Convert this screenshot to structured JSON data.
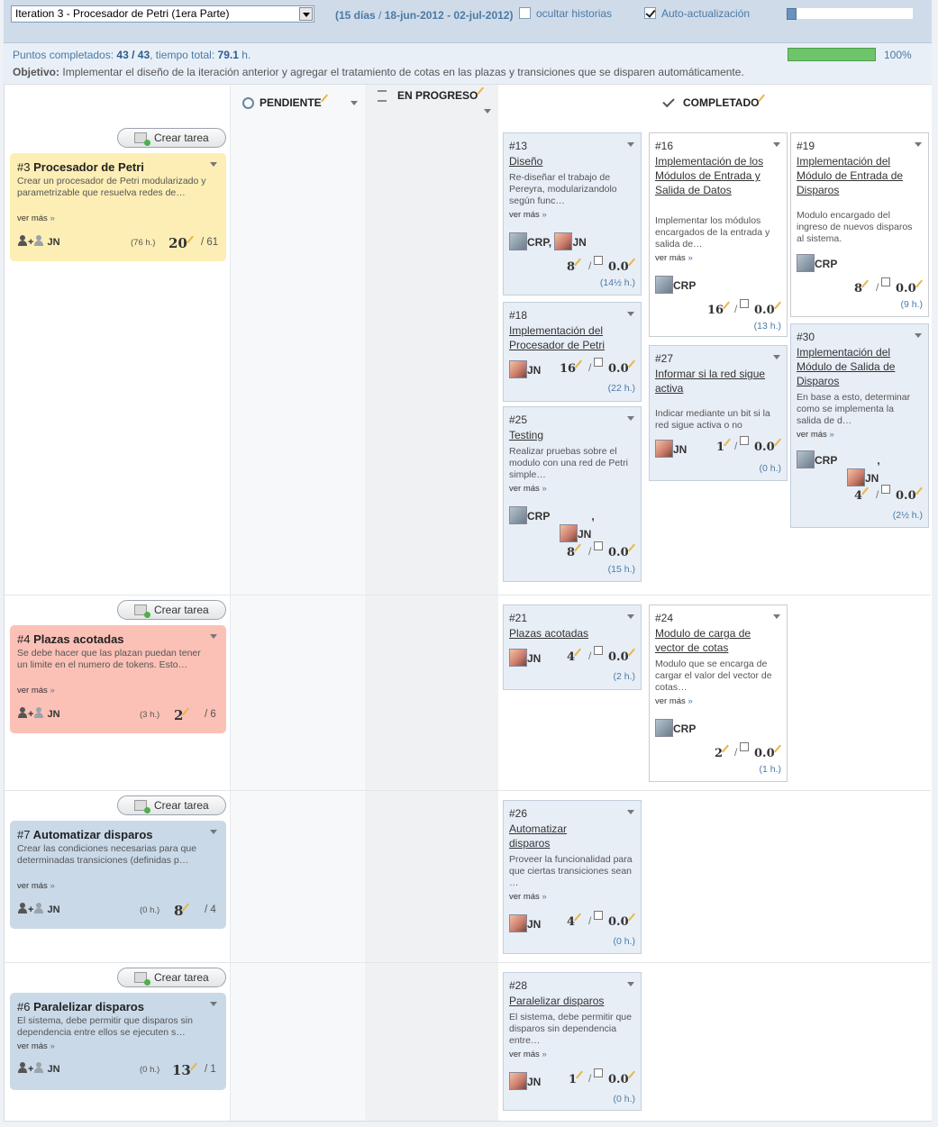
{
  "header": {
    "iteration_select": "Iteration 3 - Procesador de Petri (1era Parte)",
    "range_days": "15 días",
    "range_sep": "/",
    "range_dates": "18-jun-2012 - 02-jul-2012",
    "hide_stories_label": "ocultar historias",
    "hide_stories_checked": false,
    "auto_update_label": "Auto-actualización",
    "auto_update_checked": true
  },
  "info": {
    "points_label": "Puntos completados:",
    "points_value": "43 / 43",
    "time_label": ", tiempo total:",
    "time_value": "79.1",
    "time_unit": "h.",
    "objective_label": "Objetivo:",
    "objective_text": "Implementar el diseño de la iteración anterior y agregar el tratamiento de cotas en las plazas y transiciones que se disparen automáticamente.",
    "progress": 1.0,
    "progress_label": "100%"
  },
  "columns": {
    "pending": "PENDIENTE",
    "in_progress": "EN PROGRESO",
    "completed": "COMPLETADO"
  },
  "create_task_label": "Crear tarea",
  "more_label": "ver más",
  "more_arrow": "»",
  "stories": [
    {
      "num": "#3",
      "title": "Procesador de Petri",
      "desc": "Crear un procesador de Petri modularizado y parametrizable que resuelva redes de…",
      "owner": "JN",
      "hours": "(76 h.)",
      "points": "20",
      "total": "/ 61",
      "color": "#fdeeb5"
    },
    {
      "num": "#4",
      "title": "Plazas acotadas",
      "desc": "Se debe hacer que las plazan puedan tener un limite en el numero de tokens. Esto…",
      "owner": "JN",
      "hours": "(3 h.)",
      "points": "2",
      "total": "/ 6",
      "color": "#fbc0b6"
    },
    {
      "num": "#7",
      "title": "Automatizar disparos",
      "desc": "Crear las condiciones necesarias para que determinadas transiciones (definidas p…",
      "owner": "JN",
      "hours": "(0 h.)",
      "points": "8",
      "total": "/ 4",
      "color": "#c9d9e8"
    },
    {
      "num": "#6",
      "title": "Paralelizar disparos",
      "desc": "El sistema, debe permitir que disparos sin dependencia entre ellos se ejecuten s…",
      "owner": "JN",
      "hours": "(0 h.)",
      "points": "13",
      "total": "/ 1",
      "color": "#c9d9e8"
    }
  ],
  "tasks": [
    {
      "num": "#13",
      "title": "Diseño",
      "desc": "Re-diseñar el trabajo de Pereyra, modularizandolo según func…",
      "owners": [
        "CRP,",
        "JN"
      ],
      "points": "8",
      "remaining": "0.0",
      "hours": "(14½ h.)"
    },
    {
      "num": "#16",
      "title": "Implementación de los Módulos de Entrada y Salida de Datos",
      "desc": "Implementar los módulos encargados de la entrada y salida de…",
      "owners": [
        "CRP"
      ],
      "points": "16",
      "remaining": "0.0",
      "hours": "(13 h.)"
    },
    {
      "num": "#19",
      "title": "Implementación del Módulo de Entrada de Disparos",
      "desc": "Modulo encargado del ingreso de nuevos disparos al sistema.",
      "owners": [
        "CRP"
      ],
      "points": "8",
      "remaining": "0.0",
      "hours": "(9 h.)"
    },
    {
      "num": "#18",
      "title": "Implementación del Procesador de Petri",
      "desc": "",
      "owners": [
        "JN"
      ],
      "points": "16",
      "remaining": "0.0",
      "hours": "(22 h.)"
    },
    {
      "num": "#27",
      "title": "Informar si la red sigue activa",
      "desc": "Indicar mediante un bit si la red sigue activa o no",
      "owners": [
        "JN"
      ],
      "points": "1",
      "remaining": "0.0",
      "hours": "(0 h.)"
    },
    {
      "num": "#30",
      "title": "Implementación del Módulo de Salida de Disparos",
      "desc": "En base a esto, determinar como se implementa la salida de d…",
      "owners": [
        "CRP",
        "JN"
      ],
      "points": "4",
      "remaining": "0.0",
      "hours": "(2½ h.)"
    },
    {
      "num": "#25",
      "title": "Testing",
      "desc": "Realizar pruebas sobre el modulo con una red de Petri simple…",
      "owners": [
        "CRP",
        "JN"
      ],
      "points": "8",
      "remaining": "0.0",
      "hours": "(15 h.)"
    },
    {
      "num": "#21",
      "title": "Plazas acotadas",
      "desc": "",
      "owners": [
        "JN"
      ],
      "points": "4",
      "remaining": "0.0",
      "hours": "(2 h.)"
    },
    {
      "num": "#24",
      "title": "Modulo de carga de vector de cotas",
      "desc": "Modulo que se encarga de cargar el valor del vector de cotas…",
      "owners": [
        "CRP"
      ],
      "points": "2",
      "remaining": "0.0",
      "hours": "(1 h.)"
    },
    {
      "num": "#26",
      "title": "Automatizar disparos",
      "desc": "Proveer la funcionalidad para que ciertas transiciones sean …",
      "owners": [
        "JN"
      ],
      "points": "4",
      "remaining": "0.0",
      "hours": "(0 h.)"
    },
    {
      "num": "#28",
      "title": "Paralelizar disparos",
      "desc": "El sistema, debe permitir que disparos sin dependencia entre…",
      "owners": [
        "JN"
      ],
      "points": "1",
      "remaining": "0.0",
      "hours": "(0 h.)"
    }
  ]
}
